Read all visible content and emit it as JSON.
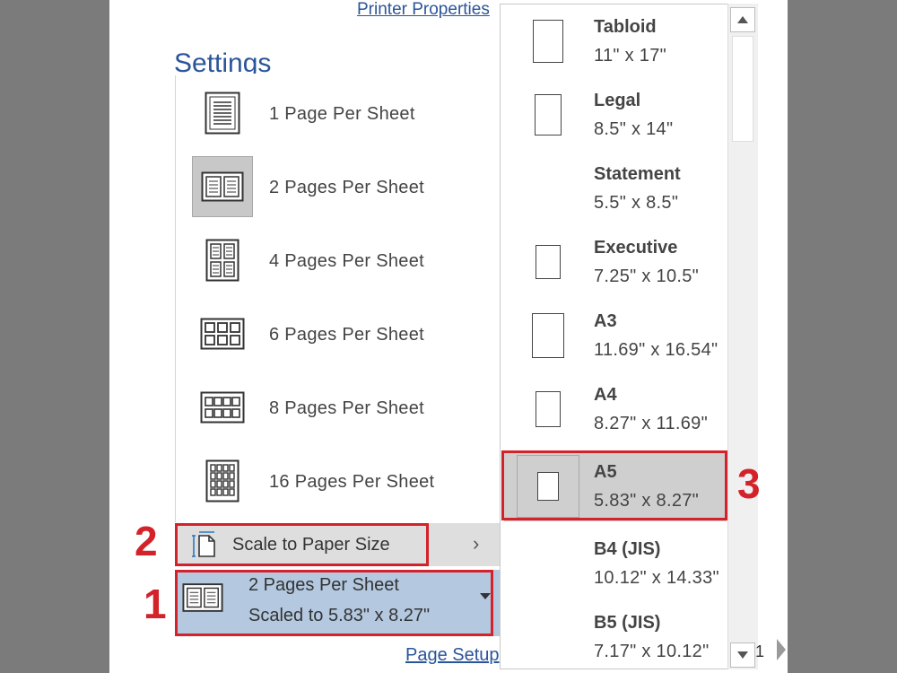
{
  "header": {
    "printer_properties": "Printer Properties",
    "settings_title": "Settings"
  },
  "pages_per_sheet_menu": {
    "items": [
      {
        "label": "1 Page Per Sheet",
        "icon": "one-page-icon"
      },
      {
        "label": "2 Pages Per Sheet",
        "icon": "two-pages-icon",
        "selected": true
      },
      {
        "label": "4 Pages Per Sheet",
        "icon": "four-pages-icon"
      },
      {
        "label": "6 Pages Per Sheet",
        "icon": "six-pages-icon"
      },
      {
        "label": "8 Pages Per Sheet",
        "icon": "eight-pages-icon"
      },
      {
        "label": "16 Pages Per Sheet",
        "icon": "sixteen-pages-icon"
      }
    ],
    "scale_to_paper_size": "Scale to Paper Size"
  },
  "pages_per_sheet_button": {
    "line1": "2 Pages Per Sheet",
    "line2": "Scaled to 5.83\" x 8.27\""
  },
  "footer": {
    "page_setup": "Page Setup",
    "page_number": "1"
  },
  "paper_size_menu": {
    "items": [
      {
        "name": "Tabloid",
        "dimensions": "11\" x 17\""
      },
      {
        "name": "Legal",
        "dimensions": "8.5\" x 14\""
      },
      {
        "name": "Statement",
        "dimensions": "5.5\" x 8.5\""
      },
      {
        "name": "Executive",
        "dimensions": "7.25\" x 10.5\""
      },
      {
        "name": "A3",
        "dimensions": "11.69\" x 16.54\""
      },
      {
        "name": "A4",
        "dimensions": "8.27\" x 11.69\""
      },
      {
        "name": "A5",
        "dimensions": "5.83\" x 8.27\"",
        "selected": true
      },
      {
        "name": "B4 (JIS)",
        "dimensions": "10.12\" x 14.33\""
      },
      {
        "name": "B5 (JIS)",
        "dimensions": "7.17\" x 10.12\""
      }
    ]
  },
  "annotations": {
    "step1": "1",
    "step2": "2",
    "step3": "3"
  },
  "colors": {
    "link_blue": "#2a5599",
    "highlight_red": "#d3222a",
    "selected_blue": "#b4c8e0",
    "selected_gray": "#cfcfcf"
  }
}
